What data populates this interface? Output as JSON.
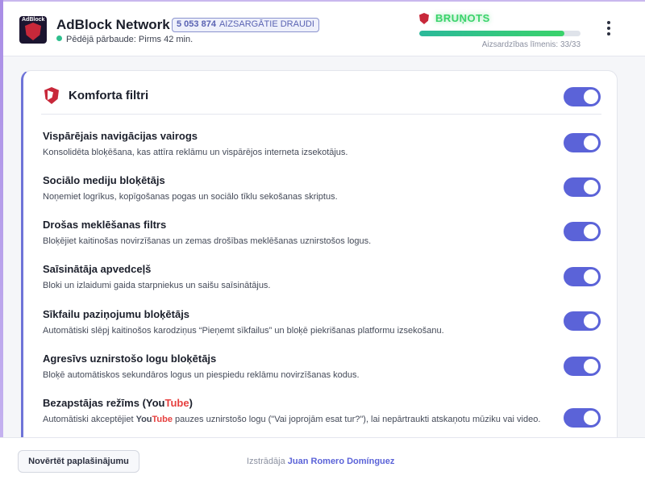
{
  "header": {
    "logo_text": "AdBlock",
    "app_title": "AdBlock Network",
    "blocked_count": "5 053 874",
    "blocked_label": "AIZSARGĀTIE DRAUDI",
    "last_check_label": "Pēdējā pārbaude: Pirms 42 min.",
    "status_text": "BRUŅOTS",
    "protection_level_label": "Aizsardzības līmenis: 33/33",
    "protection_progress": 0.9,
    "colors": {
      "accent": "#5b63d8",
      "status": "#3ad36b",
      "danger": "#c8283a"
    }
  },
  "card": {
    "title": "Komforta filtri",
    "master_enabled": true,
    "filters": [
      {
        "title": "Vispārējais navigācijas vairogs",
        "desc": "Konsolidēta bloķēšana, kas attīra reklāmu un vispārējos interneta izsekotājus.",
        "enabled": true
      },
      {
        "title": "Sociālo mediju bloķētājs",
        "desc": "Noņemiet logrīkus, kopīgošanas pogas un sociālo tīklu sekošanas skriptus.",
        "enabled": true
      },
      {
        "title": "Drošas meklēšanas filtrs",
        "desc": "Bloķējiet kaitinošas novirzīšanas un zemas drošības meklēšanas uznirstošos logus.",
        "enabled": true
      },
      {
        "title": "Saīsinātāja apvedceļš",
        "desc": "Bloki un izlaidumi gaida starpniekus un saišu saīsinātājus.",
        "enabled": true
      },
      {
        "title": "Sīkfailu paziņojumu bloķētājs",
        "desc": "Automātiski slēpj kaitinošos karodziņus “Pieņemt sīkfailus” un bloķē piekrišanas platformu izsekošanu.",
        "enabled": true
      },
      {
        "title": "Agresīvs uznirstošo logu bloķētājs",
        "desc": "Bloķē automātiskos sekundāros logus un piespiedu reklāmu novirzīšanas kodus.",
        "enabled": true
      }
    ],
    "youtube_filter": {
      "title_prefix": "Bezapstājas režīms (",
      "you": "You",
      "tube": "Tube",
      "title_suffix": ")",
      "desc_prefix": "Automātiski akceptējiet ",
      "desc_suffix": " pauzes uznirstošo logu (\"Vai joprojām esat tur?\"), lai nepārtraukti atskaņotu mūziku vai video.",
      "enabled": true
    }
  },
  "footer": {
    "reset_label": "Novērtēt paplašinājumu",
    "credit_prefix": "Izstrādāja",
    "author": "Juan Romero Domínguez"
  }
}
